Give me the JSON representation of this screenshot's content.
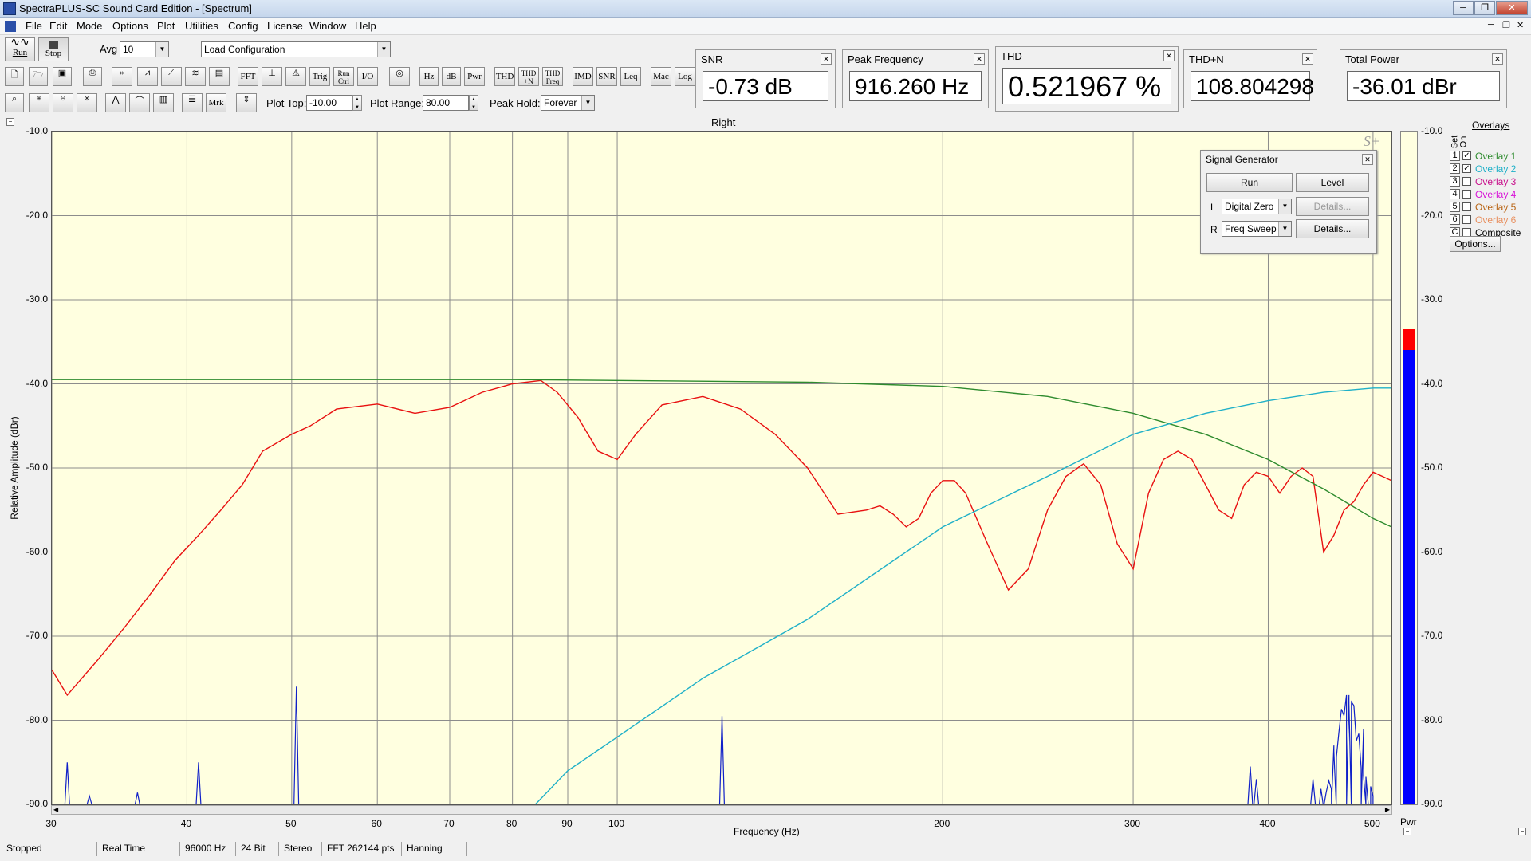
{
  "window": {
    "title": "SpectraPLUS-SC Sound Card Edition - [Spectrum]"
  },
  "menu": [
    "File",
    "Edit",
    "Mode",
    "Options",
    "Plot",
    "Utilities",
    "Config",
    "License",
    "Window",
    "Help"
  ],
  "toolbar": {
    "run_label": "Run",
    "stop_label": "Stop",
    "avg_label": "Avg",
    "avg_value": "10",
    "load_config": "Load Configuration",
    "plot_top_label": "Plot Top:",
    "plot_top_value": "-10.00",
    "plot_range_label": "Plot Range:",
    "plot_range_value": "80.00",
    "peak_hold_label": "Peak Hold:",
    "peak_hold_value": "Forever",
    "icons_row2": [
      "FFT",
      "Trig",
      "Run Ctrl",
      "I/O",
      "Hz",
      "dB",
      "Pwr",
      "THD",
      "THD +N",
      "THD Freq",
      "IMD",
      "SNR",
      "Leq",
      "Mac",
      "Log"
    ],
    "icons_row3": [
      "Mrk"
    ]
  },
  "meters": [
    {
      "title": "SNR",
      "value": "-0.73 dB"
    },
    {
      "title": "Peak Frequency",
      "value": "916.260 Hz"
    },
    {
      "title": "THD",
      "value": "0.521967 %"
    },
    {
      "title": "THD+N",
      "value": "108.804298"
    },
    {
      "title": "Total Power",
      "value": "-36.01 dBr"
    }
  ],
  "plot": {
    "channel_title": "Right",
    "ylabel": "Relative Amplitude (dBr)",
    "xlabel": "Frequency (Hz)",
    "y_ticks": [
      "-10.0",
      "-20.0",
      "-30.0",
      "-40.0",
      "-50.0",
      "-60.0",
      "-70.0",
      "-80.0",
      "-90.0"
    ],
    "x_ticks": [
      "30",
      "40",
      "50",
      "60",
      "70",
      "80",
      "90",
      "100",
      "200",
      "300",
      "400",
      "500"
    ],
    "pwr_label": "Pwr",
    "colors": {
      "background": "#ffffe0",
      "grid": "#8c8c8c",
      "red_trace": "#e81010",
      "green_trace": "#2e8b2e",
      "cyan_trace": "#1fb0c8",
      "blue_trace": "#1020c8",
      "pwr_red": "#ff0000",
      "pwr_blue": "#0000ff"
    }
  },
  "chart_data": {
    "type": "line",
    "title": "Right",
    "xlabel": "Frequency (Hz)",
    "ylabel": "Relative Amplitude (dBr)",
    "xscale": "log",
    "xlim": [
      30,
      520
    ],
    "ylim": [
      -90,
      -10
    ],
    "grid": true,
    "series": [
      {
        "name": "",
        "color": "#e81010",
        "x": [
          30,
          31,
          33,
          35,
          37,
          39,
          41,
          43,
          45,
          47,
          50,
          52,
          55,
          60,
          65,
          70,
          75,
          80,
          85,
          88,
          92,
          96,
          100,
          104,
          110,
          120,
          130,
          140,
          150,
          160,
          170,
          175,
          180,
          185,
          190,
          195,
          200,
          205,
          210,
          220,
          230,
          240,
          250,
          260,
          270,
          280,
          290,
          300,
          310,
          320,
          330,
          340,
          350,
          360,
          370,
          380,
          390,
          400,
          410,
          420,
          430,
          440,
          450,
          460,
          470,
          480,
          490,
          500,
          510,
          520
        ],
        "y": [
          -74,
          -77,
          -73,
          -69,
          -65,
          -61,
          -58,
          -55,
          -52,
          -48,
          -46,
          -45,
          -43,
          -42.4,
          -43.5,
          -42.8,
          -41,
          -40,
          -39.6,
          -41,
          -44,
          -48,
          -49,
          -46,
          -42.5,
          -41.5,
          -43,
          -46,
          -50,
          -55.5,
          -55,
          -54.5,
          -55.5,
          -57,
          -56,
          -53,
          -51.5,
          -51.5,
          -53,
          -59,
          -64.5,
          -62,
          -55,
          -51,
          -49.5,
          -52,
          -59,
          -62,
          -53,
          -49,
          -48,
          -49,
          -52,
          -55,
          -56,
          -52,
          -50.5,
          -51,
          -53,
          -51,
          -50,
          -51,
          -60,
          -58,
          -55,
          -54,
          -52,
          -50.5,
          -51,
          -51.5
        ]
      },
      {
        "name": "Overlay 1",
        "color": "#2e8b2e",
        "x": [
          30,
          50,
          80,
          100,
          150,
          200,
          250,
          300,
          350,
          400,
          450,
          500,
          520
        ],
        "y": [
          -39.5,
          -39.5,
          -39.5,
          -39.6,
          -39.8,
          -40.3,
          -41.5,
          -43.5,
          -46,
          -49,
          -52.5,
          -56,
          -57
        ]
      },
      {
        "name": "Overlay 2",
        "color": "#1fb0c8",
        "x": [
          30,
          80,
          84,
          90,
          100,
          120,
          150,
          200,
          250,
          300,
          350,
          400,
          450,
          500,
          520
        ],
        "y": [
          -90,
          -90,
          -90,
          -86,
          -82,
          -75,
          -68,
          -57,
          -51,
          -46,
          -43.5,
          -42,
          -41,
          -40.5,
          -40.5
        ]
      }
    ]
  },
  "signal_generator": {
    "title": "Signal Generator",
    "run": "Run",
    "level": "Level",
    "left_label": "L",
    "left_value": "Digital Zero",
    "left_details": "Details...",
    "right_label": "R",
    "right_value": "Freq Sweep",
    "right_details": "Details..."
  },
  "overlays": {
    "title": "Overlays",
    "col_set": "Set",
    "col_on": "On",
    "items": [
      {
        "num": "1",
        "name": "Overlay 1",
        "checked": true,
        "color": "#2e8b2e"
      },
      {
        "num": "2",
        "name": "Overlay 2",
        "checked": true,
        "color": "#1fb0c8"
      },
      {
        "num": "3",
        "name": "Overlay 3",
        "checked": false,
        "color": "#c8108c"
      },
      {
        "num": "4",
        "name": "Overlay 4",
        "checked": false,
        "color": "#d814d8"
      },
      {
        "num": "5",
        "name": "Overlay 5",
        "checked": false,
        "color": "#b86414"
      },
      {
        "num": "6",
        "name": "Overlay 6",
        "checked": false,
        "color": "#e89060"
      },
      {
        "num": "C",
        "name": "Composite",
        "checked": false,
        "color": "#000000"
      }
    ],
    "options": "Options..."
  },
  "pwr_meter": {
    "red_top_dbr": -36,
    "blue_top_dbr": -36,
    "labels": [
      "-10.0",
      "-20.0",
      "-30.0",
      "-40.0",
      "-50.0",
      "-60.0",
      "-70.0",
      "-80.0",
      "-90.0"
    ]
  },
  "status": [
    "Stopped",
    "Real Time",
    "96000 Hz",
    "24 Bit",
    "Stereo",
    "FFT 262144 pts",
    "Hanning"
  ]
}
